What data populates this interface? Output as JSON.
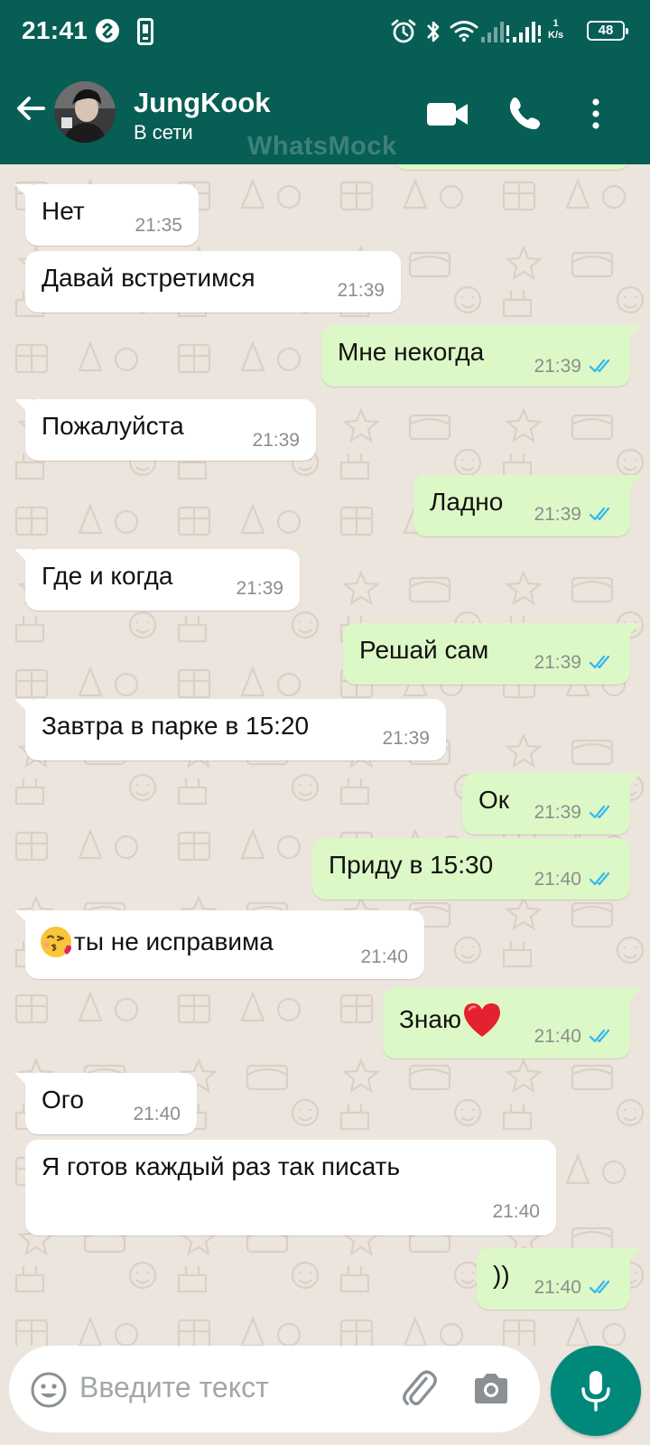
{
  "status_bar": {
    "time": "21:41",
    "net_speed_value": "1",
    "net_speed_unit": "K/s",
    "battery": "48"
  },
  "header": {
    "contact_name": "JungKook",
    "contact_status": "В сети",
    "watermark": "WhatsMock"
  },
  "messages": [
    {
      "side": "in",
      "text": "Нет",
      "time": "21:35"
    },
    {
      "side": "in",
      "text": "Давай встретимся",
      "time": "21:39"
    },
    {
      "side": "out",
      "text": "Мне некогда",
      "time": "21:39",
      "read": true
    },
    {
      "side": "in",
      "text": "Пожалуйста",
      "time": "21:39"
    },
    {
      "side": "out",
      "text": "Ладно",
      "time": "21:39",
      "read": true
    },
    {
      "side": "in",
      "text": "Где и когда",
      "time": "21:39"
    },
    {
      "side": "out",
      "text": "Решай сам",
      "time": "21:39",
      "read": true
    },
    {
      "side": "in",
      "text": "Завтра в парке в 15:20",
      "time": "21:39"
    },
    {
      "side": "out",
      "text": "Ок",
      "time": "21:39",
      "read": true
    },
    {
      "side": "out",
      "text": "Приду в 15:30",
      "time": "21:40",
      "read": true
    },
    {
      "side": "in",
      "text": "ты не исправима",
      "emoji": "kissing-face-with-heart-emoji",
      "time": "21:40"
    },
    {
      "side": "out",
      "text": "Знаю",
      "emoji": "red-heart-emoji",
      "time": "21:40",
      "read": true
    },
    {
      "side": "in",
      "text": "Ого",
      "time": "21:40"
    },
    {
      "side": "in",
      "text": "Я готов каждый раз так писать",
      "time": "21:40"
    },
    {
      "side": "out",
      "text": "))",
      "time": "21:40",
      "read": true
    }
  ],
  "composer": {
    "placeholder": "Введите текст"
  },
  "colors": {
    "header": "#075e54",
    "chat_background": "#ece5dd",
    "incoming_bubble": "#ffffff",
    "outgoing_bubble": "#dcf8c6",
    "read_ticks": "#34b7f1",
    "mic_button": "#00897b"
  },
  "icons": {
    "status": [
      "shazam-icon",
      "phone-sim-icon",
      "alarm-icon",
      "bluetooth-icon",
      "wifi-icon",
      "signal-icon"
    ],
    "header": [
      "back-arrow-icon",
      "video-call-icon",
      "voice-call-icon",
      "more-options-icon"
    ],
    "composer": [
      "emoji-icon",
      "attach-icon",
      "camera-icon",
      "mic-icon"
    ]
  }
}
